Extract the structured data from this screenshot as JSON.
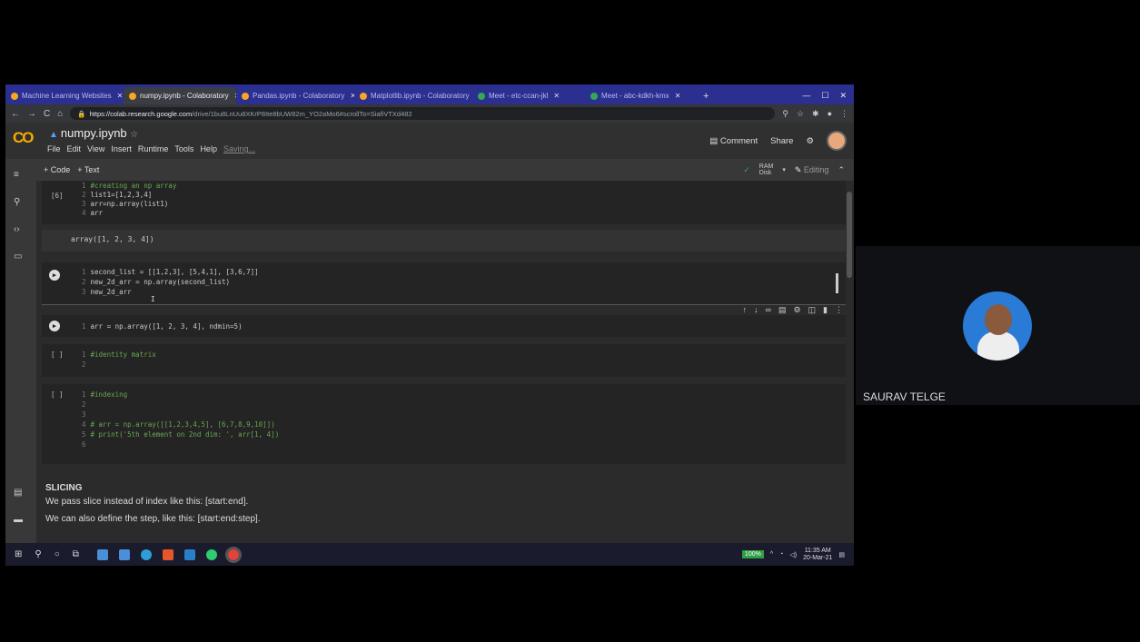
{
  "tabs": [
    {
      "label": "Machine Learning Websites",
      "active": false
    },
    {
      "label": "numpy.ipynb - Colaboratory",
      "active": true
    },
    {
      "label": "Pandas.ipynb - Colaboratory",
      "active": false
    },
    {
      "label": "Matplotlib.ipynb - Colaboratory",
      "active": false
    },
    {
      "label": "Meet - etc-ccan-jkl",
      "active": false
    },
    {
      "label": "Meet - abc-kdkh-kmx",
      "active": false
    }
  ],
  "address": {
    "domain": "https://colab.research.google.com",
    "path": "/drive/1bu8LnUu8XKrP8Ite8bUW82m_YO2aMo6#scrollTo=SiafiVTXd482"
  },
  "colab": {
    "title": "numpy.ipynb",
    "menu": [
      "File",
      "Edit",
      "View",
      "Insert",
      "Runtime",
      "Tools",
      "Help"
    ],
    "saving": "Saving...",
    "comment": "Comment",
    "share": "Share"
  },
  "toolbar": {
    "add_code": "+ Code",
    "add_text": "+ Text",
    "ram": "RAM",
    "disk": "Disk",
    "editing": "Editing"
  },
  "cells": {
    "c1": {
      "tag": "[6]",
      "lines": [
        "#creating an np array",
        "list1=[1,2,3,4]",
        "arr=np.array(list1)",
        "arr"
      ],
      "output": "array([1, 2, 3, 4])"
    },
    "c2": {
      "lines": [
        "second_list = [[1,2,3], [5,4,1], [3,6,7]]",
        "new_2d_arr = np.array(second_list)",
        "new_2d_arr"
      ]
    },
    "c3": {
      "lines": [
        "arr = np.array([1, 2, 3, 4], ndmin=5)"
      ]
    },
    "c4": {
      "tag": "[ ]",
      "lines": [
        "#identity matrix",
        ""
      ]
    },
    "c5": {
      "tag": "[ ]",
      "lines": [
        "#indexing",
        "",
        "",
        "# arr = np.array([[1,2,3,4,5], [6,7,8,9,10]])",
        "# print('5th element on 2nd dim: ', arr[1, 4])",
        ""
      ]
    }
  },
  "text_cell": {
    "heading": "SLICING",
    "p1": "We pass slice instead of index like this: [start:end].",
    "p2": "We can also define the step, like this: [start:end:step]."
  },
  "taskbar": {
    "battery": "100%",
    "time": "11:35 AM",
    "date": "20-Mar-21"
  },
  "participant": {
    "name": "SAURAV TELGE"
  },
  "colors": {
    "accent": "#f9ab00",
    "tabbar": "#2b2f8f",
    "comment_green": "#6aa84f"
  }
}
